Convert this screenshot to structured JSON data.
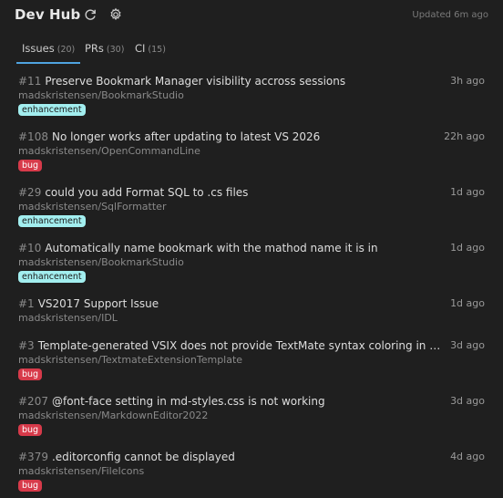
{
  "header": {
    "title": "Dev Hub",
    "refresh_icon": "refresh-icon",
    "settings_icon": "gear-icon",
    "updated": "Updated 6m ago"
  },
  "tabs": [
    {
      "label": "Issues",
      "count": "(20)",
      "active": true
    },
    {
      "label": "PRs",
      "count": "(30)",
      "active": false
    },
    {
      "label": "CI",
      "count": "(15)",
      "active": false
    }
  ],
  "items": [
    {
      "number": "#11",
      "title": "Preserve Bookmark Manager visibility accross sessions",
      "repo": "madskristensen/BookmarkStudio",
      "time": "3h ago",
      "label": "enhancement"
    },
    {
      "number": "#108",
      "title": "No longer works after updating to latest VS 2026",
      "repo": "madskristensen/OpenCommandLine",
      "time": "22h ago",
      "label": "bug"
    },
    {
      "number": "#29",
      "title": "could you add Format SQL to .cs files",
      "repo": "madskristensen/SqlFormatter",
      "time": "1d ago",
      "label": "enhancement"
    },
    {
      "number": "#10",
      "title": "Automatically name bookmark with the mathod name it is in",
      "repo": "madskristensen/BookmarkStudio",
      "time": "1d ago",
      "label": "enhancement"
    },
    {
      "number": "#1",
      "title": "VS2017 Support Issue",
      "repo": "madskristensen/IDL",
      "time": "1d ago",
      "label": ""
    },
    {
      "number": "#3",
      "title": "Template-generated VSIX does not provide TextMate syntax coloring in Visual Studio",
      "repo": "madskristensen/TextmateExtensionTemplate",
      "time": "3d ago",
      "label": "bug"
    },
    {
      "number": "#207",
      "title": "@font-face setting in md-styles.css is not working",
      "repo": "madskristensen/MarkdownEditor2022",
      "time": "3d ago",
      "label": "bug"
    },
    {
      "number": "#379",
      "title": ".editorconfig cannot be displayed",
      "repo": "madskristensen/FileIcons",
      "time": "4d ago",
      "label": "bug"
    }
  ]
}
